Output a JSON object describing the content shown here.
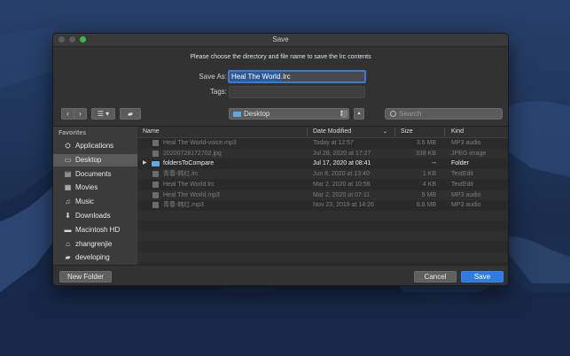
{
  "window": {
    "title": "Save"
  },
  "dialog": {
    "message": "Please choose the directory and file name to save the lrc contents",
    "save_as_label": "Save As:",
    "save_as_selected": "Heal The World",
    "save_as_extension": ".lrc",
    "tags_label": "Tags:",
    "tags_value": ""
  },
  "toolbar": {
    "back_icon": "chevron-left-icon",
    "forward_icon": "chevron-right-icon",
    "view_icon": "list-view-icon",
    "location": "Desktop",
    "search_placeholder": "Search"
  },
  "sidebar": {
    "heading": "Favorites",
    "items": [
      {
        "label": "Applications",
        "icon": "applications-icon",
        "glyph": "⛭"
      },
      {
        "label": "Desktop",
        "icon": "desktop-icon",
        "glyph": "▭",
        "selected": true
      },
      {
        "label": "Documents",
        "icon": "documents-icon",
        "glyph": "▤"
      },
      {
        "label": "Movies",
        "icon": "movies-icon",
        "glyph": "▦"
      },
      {
        "label": "Music",
        "icon": "music-icon",
        "glyph": "♫"
      },
      {
        "label": "Downloads",
        "icon": "downloads-icon",
        "glyph": "⬇"
      },
      {
        "label": "Macintosh HD",
        "icon": "hard-drive-icon",
        "glyph": "▬"
      },
      {
        "label": "zhangrenjie",
        "icon": "home-icon",
        "glyph": "⌂"
      },
      {
        "label": "developing",
        "icon": "folder-icon",
        "glyph": "▰"
      }
    ]
  },
  "columns": {
    "name": "Name",
    "date": "Date Modified",
    "size": "Size",
    "kind": "Kind"
  },
  "files": [
    {
      "name": "Heal The World-voice.mp3",
      "date": "Today at 12:57",
      "size": "3.6 MB",
      "kind": "MP3 audio",
      "folder": false
    },
    {
      "name": "20200728172702.jpg",
      "date": "Jul 28, 2020 at 17:27",
      "size": "338 KB",
      "kind": "JPEG image",
      "folder": false
    },
    {
      "name": "foldersToCompare",
      "date": "Jul 17, 2020 at 08:41",
      "size": "--",
      "kind": "Folder",
      "folder": true
    },
    {
      "name": "青春-韩红.lrc",
      "date": "Jun 8, 2020 at 13:40",
      "size": "1 KB",
      "kind": "TextEdit",
      "folder": false
    },
    {
      "name": "Heal The World.lrc",
      "date": "Mar 2, 2020 at 10:56",
      "size": "4 KB",
      "kind": "TextEdit",
      "folder": false
    },
    {
      "name": "Heal The World.mp3",
      "date": "Mar 2, 2020 at 07:11",
      "size": "9 MB",
      "kind": "MP3 audio",
      "folder": false
    },
    {
      "name": "青春-韩红.mp3",
      "date": "Nov 23, 2019 at 14:26",
      "size": "8.8 MB",
      "kind": "MP3 audio",
      "folder": false
    }
  ],
  "footer": {
    "new_folder": "New Folder",
    "cancel": "Cancel",
    "save": "Save"
  },
  "colors": {
    "accent": "#2f7be0",
    "folder": "#5fa9e6",
    "dialog_bg": "#323232"
  }
}
